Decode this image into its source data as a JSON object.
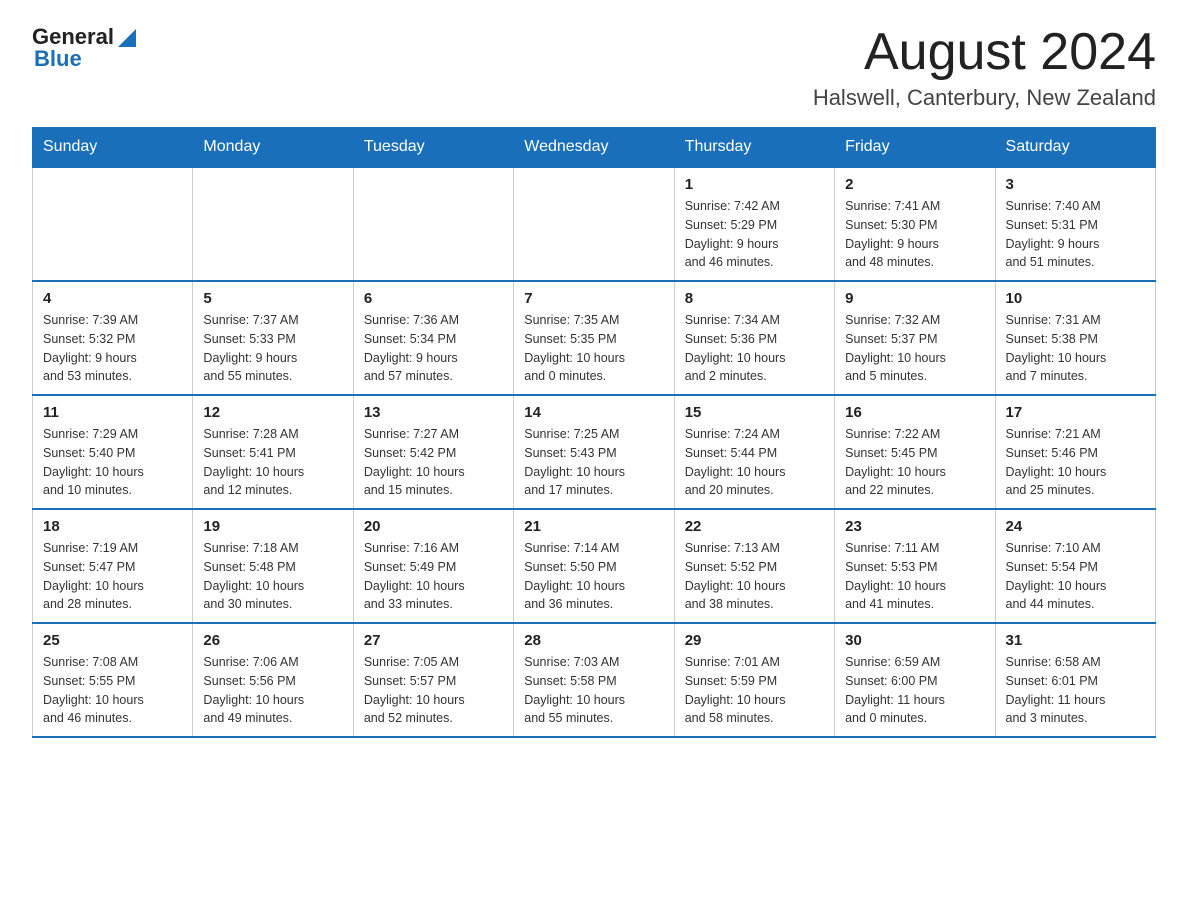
{
  "header": {
    "logo_general": "General",
    "logo_blue": "Blue",
    "month_title": "August 2024",
    "location": "Halswell, Canterbury, New Zealand"
  },
  "weekdays": [
    "Sunday",
    "Monday",
    "Tuesday",
    "Wednesday",
    "Thursday",
    "Friday",
    "Saturday"
  ],
  "weeks": [
    [
      {
        "day": "",
        "info": ""
      },
      {
        "day": "",
        "info": ""
      },
      {
        "day": "",
        "info": ""
      },
      {
        "day": "",
        "info": ""
      },
      {
        "day": "1",
        "info": "Sunrise: 7:42 AM\nSunset: 5:29 PM\nDaylight: 9 hours\nand 46 minutes."
      },
      {
        "day": "2",
        "info": "Sunrise: 7:41 AM\nSunset: 5:30 PM\nDaylight: 9 hours\nand 48 minutes."
      },
      {
        "day": "3",
        "info": "Sunrise: 7:40 AM\nSunset: 5:31 PM\nDaylight: 9 hours\nand 51 minutes."
      }
    ],
    [
      {
        "day": "4",
        "info": "Sunrise: 7:39 AM\nSunset: 5:32 PM\nDaylight: 9 hours\nand 53 minutes."
      },
      {
        "day": "5",
        "info": "Sunrise: 7:37 AM\nSunset: 5:33 PM\nDaylight: 9 hours\nand 55 minutes."
      },
      {
        "day": "6",
        "info": "Sunrise: 7:36 AM\nSunset: 5:34 PM\nDaylight: 9 hours\nand 57 minutes."
      },
      {
        "day": "7",
        "info": "Sunrise: 7:35 AM\nSunset: 5:35 PM\nDaylight: 10 hours\nand 0 minutes."
      },
      {
        "day": "8",
        "info": "Sunrise: 7:34 AM\nSunset: 5:36 PM\nDaylight: 10 hours\nand 2 minutes."
      },
      {
        "day": "9",
        "info": "Sunrise: 7:32 AM\nSunset: 5:37 PM\nDaylight: 10 hours\nand 5 minutes."
      },
      {
        "day": "10",
        "info": "Sunrise: 7:31 AM\nSunset: 5:38 PM\nDaylight: 10 hours\nand 7 minutes."
      }
    ],
    [
      {
        "day": "11",
        "info": "Sunrise: 7:29 AM\nSunset: 5:40 PM\nDaylight: 10 hours\nand 10 minutes."
      },
      {
        "day": "12",
        "info": "Sunrise: 7:28 AM\nSunset: 5:41 PM\nDaylight: 10 hours\nand 12 minutes."
      },
      {
        "day": "13",
        "info": "Sunrise: 7:27 AM\nSunset: 5:42 PM\nDaylight: 10 hours\nand 15 minutes."
      },
      {
        "day": "14",
        "info": "Sunrise: 7:25 AM\nSunset: 5:43 PM\nDaylight: 10 hours\nand 17 minutes."
      },
      {
        "day": "15",
        "info": "Sunrise: 7:24 AM\nSunset: 5:44 PM\nDaylight: 10 hours\nand 20 minutes."
      },
      {
        "day": "16",
        "info": "Sunrise: 7:22 AM\nSunset: 5:45 PM\nDaylight: 10 hours\nand 22 minutes."
      },
      {
        "day": "17",
        "info": "Sunrise: 7:21 AM\nSunset: 5:46 PM\nDaylight: 10 hours\nand 25 minutes."
      }
    ],
    [
      {
        "day": "18",
        "info": "Sunrise: 7:19 AM\nSunset: 5:47 PM\nDaylight: 10 hours\nand 28 minutes."
      },
      {
        "day": "19",
        "info": "Sunrise: 7:18 AM\nSunset: 5:48 PM\nDaylight: 10 hours\nand 30 minutes."
      },
      {
        "day": "20",
        "info": "Sunrise: 7:16 AM\nSunset: 5:49 PM\nDaylight: 10 hours\nand 33 minutes."
      },
      {
        "day": "21",
        "info": "Sunrise: 7:14 AM\nSunset: 5:50 PM\nDaylight: 10 hours\nand 36 minutes."
      },
      {
        "day": "22",
        "info": "Sunrise: 7:13 AM\nSunset: 5:52 PM\nDaylight: 10 hours\nand 38 minutes."
      },
      {
        "day": "23",
        "info": "Sunrise: 7:11 AM\nSunset: 5:53 PM\nDaylight: 10 hours\nand 41 minutes."
      },
      {
        "day": "24",
        "info": "Sunrise: 7:10 AM\nSunset: 5:54 PM\nDaylight: 10 hours\nand 44 minutes."
      }
    ],
    [
      {
        "day": "25",
        "info": "Sunrise: 7:08 AM\nSunset: 5:55 PM\nDaylight: 10 hours\nand 46 minutes."
      },
      {
        "day": "26",
        "info": "Sunrise: 7:06 AM\nSunset: 5:56 PM\nDaylight: 10 hours\nand 49 minutes."
      },
      {
        "day": "27",
        "info": "Sunrise: 7:05 AM\nSunset: 5:57 PM\nDaylight: 10 hours\nand 52 minutes."
      },
      {
        "day": "28",
        "info": "Sunrise: 7:03 AM\nSunset: 5:58 PM\nDaylight: 10 hours\nand 55 minutes."
      },
      {
        "day": "29",
        "info": "Sunrise: 7:01 AM\nSunset: 5:59 PM\nDaylight: 10 hours\nand 58 minutes."
      },
      {
        "day": "30",
        "info": "Sunrise: 6:59 AM\nSunset: 6:00 PM\nDaylight: 11 hours\nand 0 minutes."
      },
      {
        "day": "31",
        "info": "Sunrise: 6:58 AM\nSunset: 6:01 PM\nDaylight: 11 hours\nand 3 minutes."
      }
    ]
  ]
}
